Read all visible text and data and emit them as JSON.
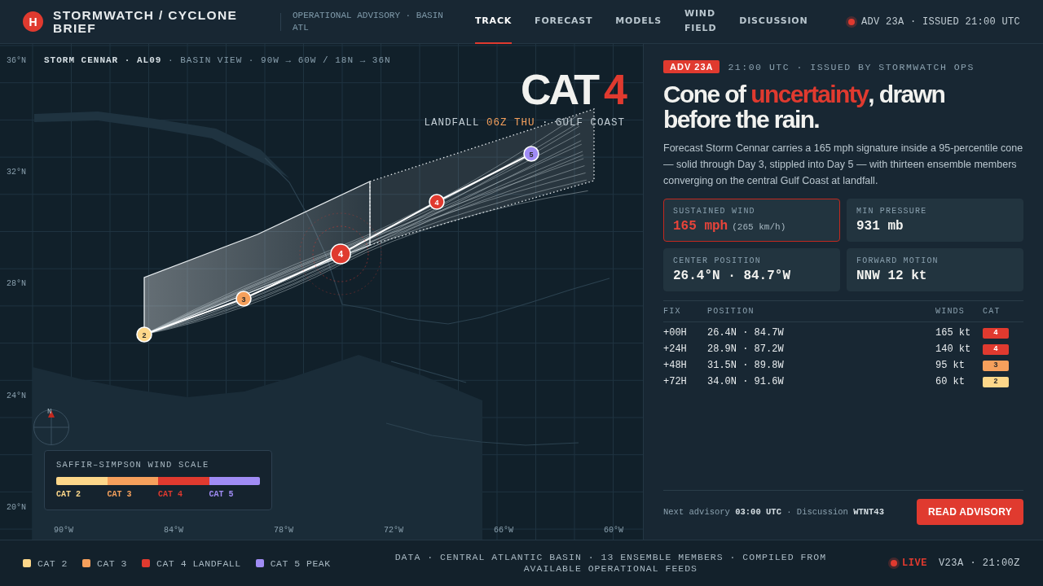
{
  "header": {
    "logo": "H",
    "brand": "STORMWATCH / CYCLONE BRIEF",
    "subtitle": "OPERATIONAL ADVISORY · BASIN ATL",
    "tabs": [
      {
        "label": "TRACK",
        "selected": true
      },
      {
        "label": "FORECAST",
        "selected": false
      },
      {
        "label": "MODELS",
        "selected": false
      },
      {
        "label": "WIND FIELD",
        "selected": false
      },
      {
        "label": "DISCUSSION",
        "selected": false
      }
    ],
    "status": "ADV 23A · ISSUED 21:00 UTC"
  },
  "map": {
    "caption_storm": "STORM CENNAR · AL09",
    "caption_view": " · BASIN VIEW · 90W → 60W / 18N → 36N",
    "category_word": "CAT",
    "category_number": "4",
    "landfall": [
      {
        "text": "LANDFALL ",
        "kind": "plain"
      },
      {
        "text": "06Z THU",
        "kind": "accent"
      },
      {
        "text": " · GULF COAST",
        "kind": "plain"
      }
    ],
    "lat_labels": [
      "36°N",
      "32°N",
      "28°N",
      "24°N",
      "20°N"
    ],
    "lon_labels": [
      "90°W",
      "84°W",
      "78°W",
      "72°W",
      "66°W",
      "60°W"
    ],
    "track_points": [
      {
        "cat": "2",
        "current": false
      },
      {
        "cat": "3",
        "current": false
      },
      {
        "cat": "4",
        "current": true
      },
      {
        "cat": "4",
        "current": false
      },
      {
        "cat": "5",
        "current": false
      }
    ],
    "compass_label": "N",
    "scale": {
      "title": "SAFFIR–SIMPSON WIND SCALE",
      "steps": [
        {
          "color": "#fdd78a",
          "label": "CAT 2"
        },
        {
          "color": "#f6a05c",
          "label": "CAT 3"
        },
        {
          "color": "#e03a2f",
          "label": "CAT 4"
        },
        {
          "color": "#a08cf5",
          "label": "CAT 5"
        }
      ]
    }
  },
  "panel": {
    "badge": "ADV 23A",
    "meta": "21:00 UTC · ISSUED BY STORMWATCH OPS",
    "headline": "Cone of **uncertainty**, drawn before the rain.",
    "summary": "Forecast Storm Cennar carries a 165 mph signature inside a 95-percentile cone — solid through Day 3, stippled into Day 5 — with thirteen ensemble members converging on the central Gulf Coast at landfall.",
    "stats": [
      {
        "label": "SUSTAINED WIND",
        "value": "165 mph",
        "sub": "(265 km/h)",
        "highlight": true
      },
      {
        "label": "MIN PRESSURE",
        "value": "931 mb",
        "highlight": false
      },
      {
        "label": "CENTER POSITION",
        "value": "26.4°N · 84.7°W",
        "highlight": false
      },
      {
        "label": "FORWARD MOTION",
        "value": "NNW 12 kt",
        "highlight": false
      }
    ],
    "table": {
      "columns": [
        "FIX",
        "POSITION",
        "WINDS",
        "CAT"
      ],
      "rows": [
        {
          "fix": "+00H",
          "position": "26.4N · 84.7W",
          "winds": "165 kt",
          "cat": "4"
        },
        {
          "fix": "+24H",
          "position": "28.9N · 87.2W",
          "winds": "140 kt",
          "cat": "4"
        },
        {
          "fix": "+48H",
          "position": "31.5N · 89.8W",
          "winds": "95 kt",
          "cat": "3"
        },
        {
          "fix": "+72H",
          "position": "34.0N · 91.6W",
          "winds": "60 kt",
          "cat": "2"
        }
      ]
    },
    "next": "Next advisory **03:00 UTC** · Discussion **WTNT43**",
    "button": "READ ADVISORY"
  },
  "footer": {
    "legend": [
      {
        "label": "CAT 2",
        "color": "#fdd78a"
      },
      {
        "label": "CAT 3",
        "color": "#f6a05c"
      },
      {
        "label": "CAT 4 LANDFALL",
        "color": "#e03a2f"
      },
      {
        "label": "CAT 5 PEAK",
        "color": "#a08cf5"
      }
    ],
    "note": "DATA · CENTRAL ATLANTIC BASIN · 13 ENSEMBLE MEMBERS · COMPILED FROM AVAILABLE OPERATIONAL FEEDS",
    "live": "LIVE",
    "version": "V23A · 21:00Z"
  }
}
